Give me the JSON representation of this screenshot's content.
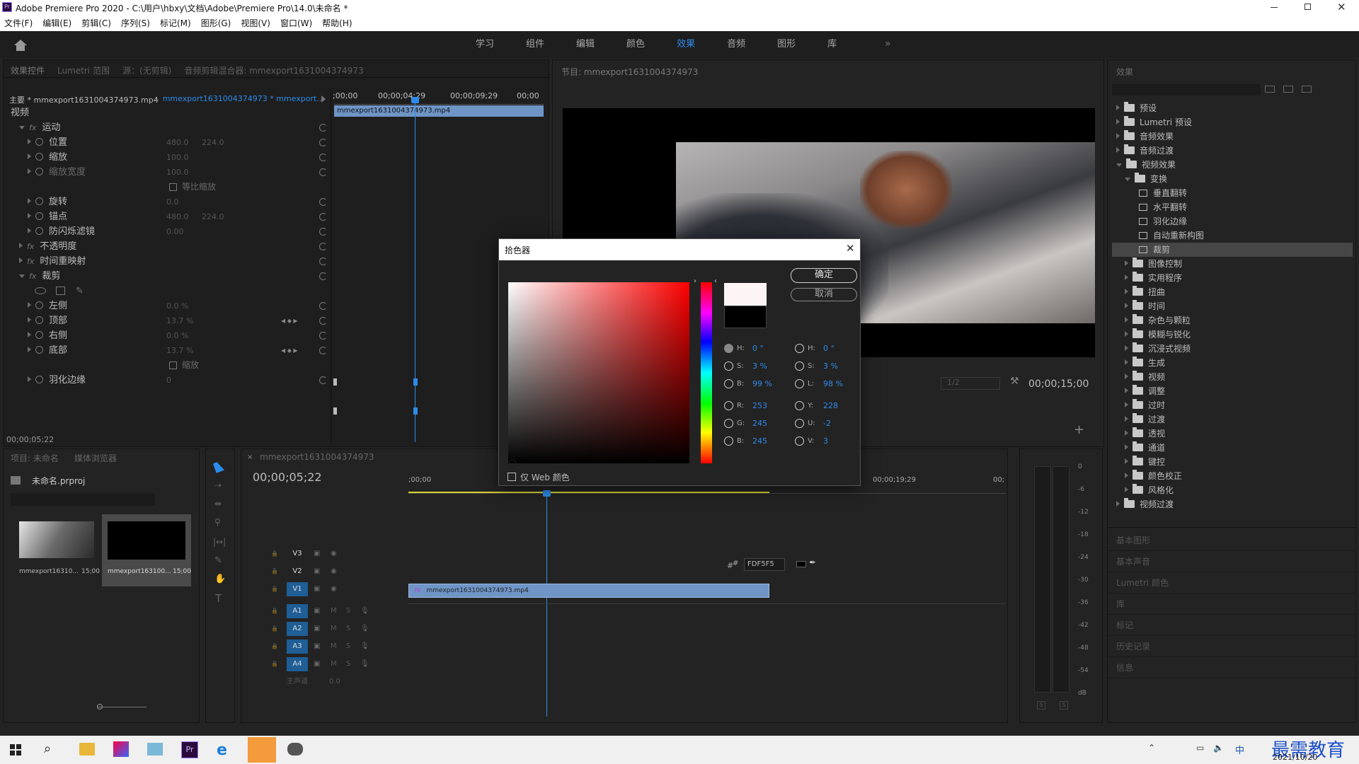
{
  "window": {
    "title": "Adobe Premiere Pro 2020 - C:\\用户\\hbxy\\文档\\Adobe\\Premiere Pro\\14.0\\未命名 *",
    "app_icon": "Pr"
  },
  "menu": [
    "文件(F)",
    "编辑(E)",
    "剪辑(C)",
    "序列(S)",
    "标记(M)",
    "图形(G)",
    "视图(V)",
    "窗口(W)",
    "帮助(H)"
  ],
  "workspaces": {
    "items": [
      "学习",
      "组件",
      "编辑",
      "颜色",
      "效果",
      "音频",
      "图形",
      "库"
    ],
    "active": "效果",
    "more": "»"
  },
  "ec": {
    "tabs": [
      "效果控件",
      "Lumetri 范围",
      "源：(无剪辑)",
      "音频剪辑混合器: mmexport1631004374973"
    ],
    "master": "主要 * mmexport1631004374973.mp4",
    "clip": "mmexport1631004374973 * mmexport...",
    "ruler": [
      ";00;00",
      "00;00;04;29",
      "00;00;09;29",
      "00;00"
    ],
    "clipbar": "mmexport1631004374973.mp4",
    "rows": [
      {
        "label": "视频",
        "value": "",
        "value2": "",
        "indent": 0,
        "kind": "hdr"
      },
      {
        "label": "运动",
        "value": "",
        "value2": "",
        "indent": 1,
        "kind": "fx"
      },
      {
        "label": "位置",
        "value": "480.0",
        "value2": "224.0",
        "indent": 2,
        "kind": "prop"
      },
      {
        "label": "缩放",
        "value": "100.0",
        "value2": "",
        "indent": 2,
        "kind": "prop"
      },
      {
        "label": "缩放宽度",
        "value": "100.0",
        "value2": "",
        "indent": 2,
        "kind": "propdim"
      },
      {
        "label": "",
        "value": "等比缩放",
        "value2": "",
        "indent": 3,
        "kind": "check"
      },
      {
        "label": "旋转",
        "value": "0.0",
        "value2": "",
        "indent": 2,
        "kind": "prop"
      },
      {
        "label": "锚点",
        "value": "480.0",
        "value2": "224.0",
        "indent": 2,
        "kind": "prop"
      },
      {
        "label": "防闪烁滤镜",
        "value": "0.00",
        "value2": "",
        "indent": 2,
        "kind": "prop"
      },
      {
        "label": "不透明度",
        "value": "",
        "value2": "",
        "indent": 1,
        "kind": "fxc"
      },
      {
        "label": "时间重映射",
        "value": "",
        "value2": "",
        "indent": 1,
        "kind": "fxc"
      },
      {
        "label": "裁剪",
        "value": "",
        "value2": "",
        "indent": 1,
        "kind": "fx"
      },
      {
        "label": "",
        "value": "",
        "value2": "",
        "indent": 2,
        "kind": "tools"
      },
      {
        "label": "左侧",
        "value": "0.0 %",
        "value2": "",
        "indent": 2,
        "kind": "prop"
      },
      {
        "label": "顶部",
        "value": "13.7 %",
        "value2": "",
        "indent": 2,
        "kind": "key"
      },
      {
        "label": "右侧",
        "value": "0.0 %",
        "value2": "",
        "indent": 2,
        "kind": "prop"
      },
      {
        "label": "底部",
        "value": "13.7 %",
        "value2": "",
        "indent": 2,
        "kind": "key"
      },
      {
        "label": "",
        "value": "缩放",
        "value2": "",
        "indent": 3,
        "kind": "check"
      },
      {
        "label": "羽化边缘",
        "value": "0",
        "value2": "",
        "indent": 2,
        "kind": "prop"
      }
    ],
    "timecode": "00;00;05;22"
  },
  "program": {
    "title": "节目: mmexport1631004374973",
    "fit": "1/2",
    "timecode": "00;00;15;00"
  },
  "project": {
    "tabs": [
      "项目: 未命名",
      "媒体浏览器"
    ],
    "file": "未命名.prproj",
    "items": [
      {
        "name": "mmexport16310...",
        "dur": "15;00"
      },
      {
        "name": "mmexport163100...",
        "dur": "15;00"
      }
    ]
  },
  "timeline": {
    "tab": "mmexport1631004374973",
    "timecode": "00;00;05;22",
    "ruler_left": ";00;00",
    "ruler_right": "00;00;19;29",
    "ruler_end": "00;",
    "tracks": [
      "V3",
      "V2",
      "V1",
      "A1",
      "A2",
      "A3",
      "A4"
    ],
    "master": "主声道",
    "master_val": "0.0",
    "clip": "mmexport1631004374973.mp4"
  },
  "meter": {
    "scale": [
      "0",
      "-6",
      "-12",
      "-18",
      "-24",
      "-30",
      "-36",
      "-42",
      "-48",
      "-54",
      "dB"
    ],
    "buttons": [
      "S",
      "S"
    ]
  },
  "effects": {
    "title": "效果",
    "tree": [
      {
        "label": "预设",
        "indent": 0,
        "icon": "star",
        "open": false
      },
      {
        "label": "Lumetri 预设",
        "indent": 0,
        "icon": "star",
        "open": false
      },
      {
        "label": "音频效果",
        "indent": 0,
        "icon": "folder",
        "open": false
      },
      {
        "label": "音频过渡",
        "indent": 0,
        "icon": "folder",
        "open": false
      },
      {
        "label": "视频效果",
        "indent": 0,
        "icon": "folder",
        "open": true
      },
      {
        "label": "变换",
        "indent": 1,
        "icon": "folder",
        "open": true
      },
      {
        "label": "垂直翻转",
        "indent": 2,
        "icon": "fx",
        "open": false
      },
      {
        "label": "水平翻转",
        "indent": 2,
        "icon": "fx",
        "open": false
      },
      {
        "label": "羽化边缘",
        "indent": 2,
        "icon": "fx",
        "open": false
      },
      {
        "label": "自动重新构图",
        "indent": 2,
        "icon": "fx",
        "open": false
      },
      {
        "label": "裁剪",
        "indent": 2,
        "icon": "fx",
        "open": false,
        "selected": true
      },
      {
        "label": "图像控制",
        "indent": 1,
        "icon": "folder",
        "open": false
      },
      {
        "label": "实用程序",
        "indent": 1,
        "icon": "folder",
        "open": false
      },
      {
        "label": "扭曲",
        "indent": 1,
        "icon": "folder",
        "open": false
      },
      {
        "label": "时间",
        "indent": 1,
        "icon": "folder",
        "open": false
      },
      {
        "label": "杂色与颗粒",
        "indent": 1,
        "icon": "folder",
        "open": false
      },
      {
        "label": "模糊与锐化",
        "indent": 1,
        "icon": "folder",
        "open": false
      },
      {
        "label": "沉浸式视频",
        "indent": 1,
        "icon": "folder",
        "open": false
      },
      {
        "label": "生成",
        "indent": 1,
        "icon": "folder",
        "open": false
      },
      {
        "label": "视频",
        "indent": 1,
        "icon": "folder",
        "open": false
      },
      {
        "label": "调整",
        "indent": 1,
        "icon": "folder",
        "open": false
      },
      {
        "label": "过时",
        "indent": 1,
        "icon": "folder",
        "open": false
      },
      {
        "label": "过渡",
        "indent": 1,
        "icon": "folder",
        "open": false
      },
      {
        "label": "透视",
        "indent": 1,
        "icon": "folder",
        "open": false
      },
      {
        "label": "通道",
        "indent": 1,
        "icon": "folder",
        "open": false
      },
      {
        "label": "键控",
        "indent": 1,
        "icon": "folder",
        "open": false
      },
      {
        "label": "颜色校正",
        "indent": 1,
        "icon": "folder",
        "open": false
      },
      {
        "label": "风格化",
        "indent": 1,
        "icon": "folder",
        "open": false
      },
      {
        "label": "视频过渡",
        "indent": 0,
        "icon": "folder",
        "open": false
      }
    ],
    "collapsed": [
      "基本图形",
      "基本声音",
      "Lumetri 颜色",
      "库",
      "标记",
      "历史记录",
      "信息"
    ]
  },
  "picker": {
    "title": "拾色器",
    "ok": "确定",
    "cancel": "取消",
    "web_only": "仅 Web 颜色",
    "hex_label": "#",
    "hex": "FDF5F5",
    "left": [
      {
        "k": "H:",
        "v": "0 °"
      },
      {
        "k": "S:",
        "v": "3 %"
      },
      {
        "k": "B:",
        "v": "99 %"
      },
      {
        "k": "R:",
        "v": "253"
      },
      {
        "k": "G:",
        "v": "245"
      },
      {
        "k": "B:",
        "v": "245"
      }
    ],
    "right": [
      {
        "k": "H:",
        "v": "0 °"
      },
      {
        "k": "S:",
        "v": "3 %"
      },
      {
        "k": "L:",
        "v": "98 %"
      },
      {
        "k": "Y:",
        "v": "228"
      },
      {
        "k": "U:",
        "v": "-2"
      },
      {
        "k": "V:",
        "v": "3"
      }
    ],
    "new_color": "#fdf5f5",
    "old_color": "#000000"
  },
  "tray": {
    "date": "2021/10/20",
    "watermark": "最需教育",
    "ime": "中"
  }
}
